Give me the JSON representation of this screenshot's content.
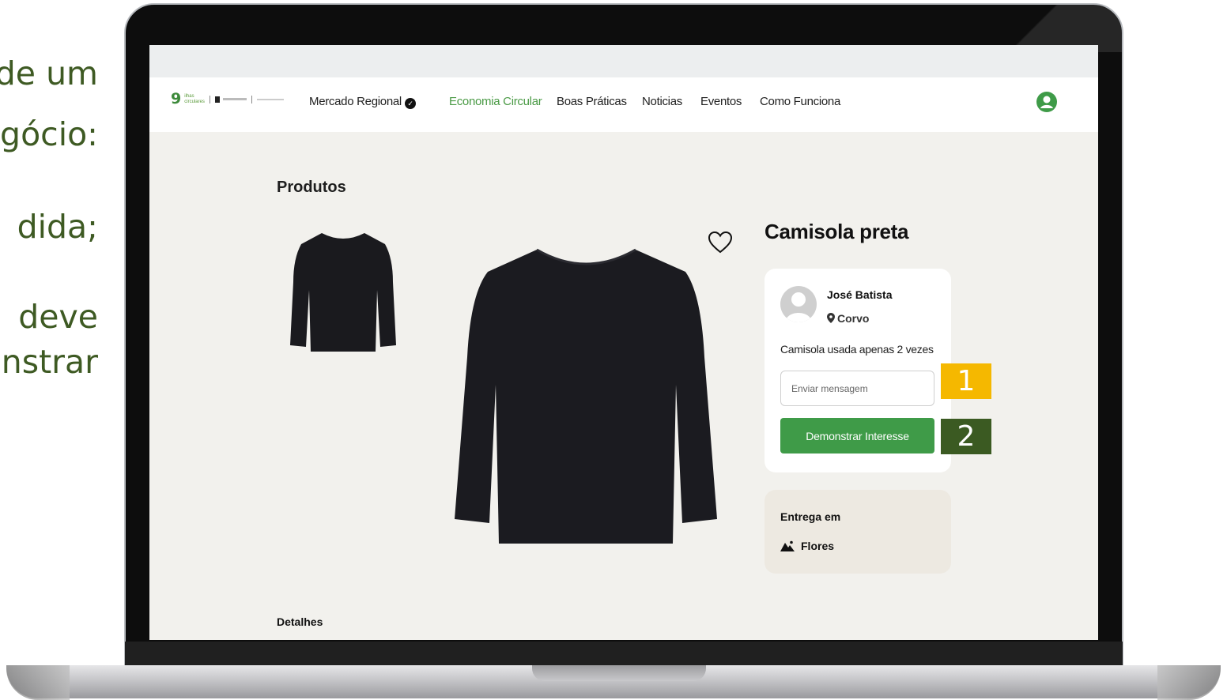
{
  "slide_text": [
    "de um",
    "gócio:",
    "dida;",
    "deve",
    "nstrar"
  ],
  "nav": {
    "logo_number": "9",
    "logo_line1": "ilhas",
    "logo_line2": "circulares",
    "items": [
      {
        "label": "Mercado Regional",
        "verified": true,
        "active": false
      },
      {
        "label": "Economia Circular",
        "active": true
      },
      {
        "label": "Boas Práticas",
        "active": false
      },
      {
        "label": "Noticias",
        "active": false
      },
      {
        "label": "Eventos",
        "active": false
      },
      {
        "label": "Como Funciona",
        "active": false
      }
    ]
  },
  "page": {
    "section_title": "Produtos",
    "product_title": "Camisola preta",
    "details_title": "Detalhes"
  },
  "seller": {
    "name": "José Batista",
    "location": "Corvo",
    "description": "Camisola usada apenas 2 vezes"
  },
  "message": {
    "placeholder": "Enviar mensagem",
    "value": ""
  },
  "actions": {
    "interest_label": "Demonstrar Interesse"
  },
  "badges": {
    "first": "1",
    "second": "2"
  },
  "delivery": {
    "title": "Entrega em",
    "place": "Flores"
  },
  "colors": {
    "accent_green": "#3f9b48",
    "nav_active": "#4a9a45",
    "badge_yellow": "#f5b800",
    "badge_dark_green": "#3b5a22",
    "slide_text": "#3e5a23"
  },
  "icons": [
    "verified-check-icon",
    "user-profile-icon",
    "heart-icon",
    "location-pin-icon",
    "mountain-icon"
  ]
}
